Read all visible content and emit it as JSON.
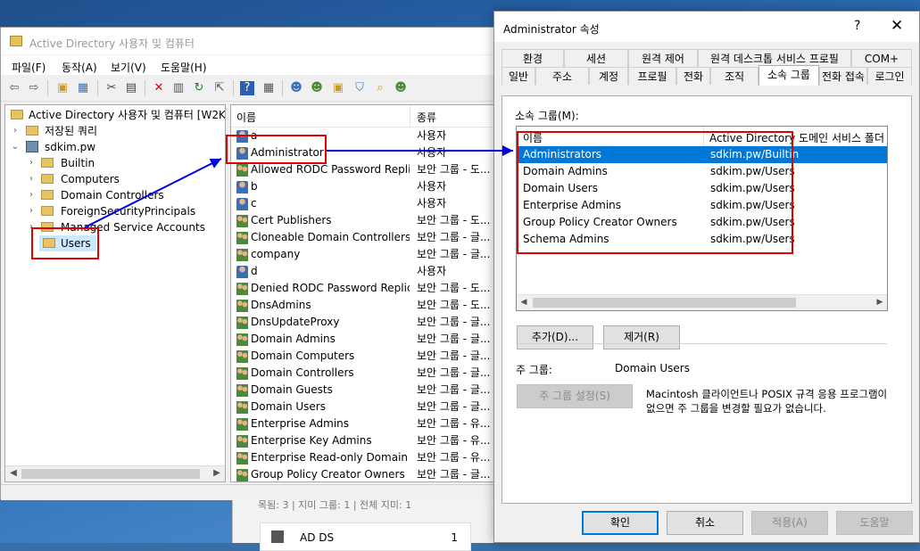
{
  "background": {
    "status_fragment": "목됨: 3  |  지미 그룹: 1  |  전체 지미: 1",
    "tile_label": "AD DS",
    "tile_count": "1"
  },
  "aduc": {
    "title": "Active Directory 사용자 및 컴퓨터",
    "menu": [
      "파일(F)",
      "동작(A)",
      "보기(V)",
      "도움말(H)"
    ],
    "toolbar_icons": [
      "back-icon",
      "forward-icon",
      "up-icon",
      "show-tree-icon",
      "cut-icon",
      "copy-icon",
      "delete-icon",
      "properties-icon",
      "refresh-icon",
      "export-icon",
      "help-icon",
      "view-icon",
      "new-user-icon",
      "new-group-icon",
      "new-ou-icon",
      "filter-icon",
      "find-icon",
      "add-to-group-icon"
    ],
    "tree": {
      "root": "Active Directory 사용자 및 컴퓨터 [W2K1",
      "saved_queries": "저장된 쿼리",
      "domain": "sdkim.pw",
      "children": [
        "Builtin",
        "Computers",
        "Domain Controllers",
        "ForeignSecurityPrincipals",
        "Managed Service Accounts",
        "Users"
      ]
    },
    "list": {
      "col_name": "이름",
      "col_type": "종류",
      "rows": [
        {
          "name": "a",
          "type": "사용자",
          "kind": "user"
        },
        {
          "name": "Administrator",
          "type": "사용자",
          "kind": "user"
        },
        {
          "name": "Allowed RODC Password Repli...",
          "type": "보안 그룹 - 도...",
          "kind": "group"
        },
        {
          "name": "b",
          "type": "사용자",
          "kind": "user"
        },
        {
          "name": "c",
          "type": "사용자",
          "kind": "user"
        },
        {
          "name": "Cert Publishers",
          "type": "보안 그룹 - 도...",
          "kind": "group"
        },
        {
          "name": "Cloneable Domain Controllers",
          "type": "보안 그룹 - 글...",
          "kind": "group"
        },
        {
          "name": "company",
          "type": "보안 그룹 - 글...",
          "kind": "group"
        },
        {
          "name": "d",
          "type": "사용자",
          "kind": "user"
        },
        {
          "name": "Denied RODC Password Replic...",
          "type": "보안 그룹 - 도...",
          "kind": "group"
        },
        {
          "name": "DnsAdmins",
          "type": "보안 그룹 - 도...",
          "kind": "group"
        },
        {
          "name": "DnsUpdateProxy",
          "type": "보안 그룹 - 글...",
          "kind": "group"
        },
        {
          "name": "Domain Admins",
          "type": "보안 그룹 - 글...",
          "kind": "group"
        },
        {
          "name": "Domain Computers",
          "type": "보안 그룹 - 글...",
          "kind": "group"
        },
        {
          "name": "Domain Controllers",
          "type": "보안 그룹 - 글...",
          "kind": "group"
        },
        {
          "name": "Domain Guests",
          "type": "보안 그룹 - 글...",
          "kind": "group"
        },
        {
          "name": "Domain Users",
          "type": "보안 그룹 - 글...",
          "kind": "group"
        },
        {
          "name": "Enterprise Admins",
          "type": "보안 그룹 - 유...",
          "kind": "group"
        },
        {
          "name": "Enterprise Key Admins",
          "type": "보안 그룹 - 유...",
          "kind": "group"
        },
        {
          "name": "Enterprise Read-only Domain ...",
          "type": "보안 그룹 - 유...",
          "kind": "group"
        },
        {
          "name": "Group Policy Creator Owners",
          "type": "보안 그룹 - 글...",
          "kind": "group"
        }
      ]
    }
  },
  "dialog": {
    "title": "Administrator 속성",
    "help": "?",
    "close": "✕",
    "tabs_row1": [
      "환경",
      "세션",
      "원격 제어",
      "원격 데스크톱 서비스 프로필",
      "COM+"
    ],
    "tabs_row2": [
      "일반",
      "주소",
      "계정",
      "프로필",
      "전화",
      "조직",
      "소속 그룹",
      "전화 접속",
      "로그인"
    ],
    "member_of_label": "소속 그룹(M):",
    "grid": {
      "col_name": "이름",
      "col_path": "Active Directory 도메인 서비스 폴더",
      "rows": [
        {
          "name": "Administrators",
          "path": "sdkim.pw/Builtin"
        },
        {
          "name": "Domain Admins",
          "path": "sdkim.pw/Users"
        },
        {
          "name": "Domain Users",
          "path": "sdkim.pw/Users"
        },
        {
          "name": "Enterprise Admins",
          "path": "sdkim.pw/Users"
        },
        {
          "name": "Group Policy Creator Owners",
          "path": "sdkim.pw/Users"
        },
        {
          "name": "Schema Admins",
          "path": "sdkim.pw/Users"
        }
      ]
    },
    "add_button": "추가(D)...",
    "remove_button": "제거(R)",
    "primary_group_label": "주 그룹:",
    "primary_group_value": "Domain Users",
    "set_primary_button": "주 그룹 설정(S)",
    "note": "Macintosh 클라이언트나 POSIX 규격 응용 프로그램이 없으면 주 그룹을 변경할 필요가 없습니다.",
    "ok": "확인",
    "cancel": "취소",
    "apply": "적용(A)",
    "help_button": "도움말"
  },
  "colors": {
    "annotation_red": "#e00000",
    "annotation_arrow": "#0000dd",
    "selection": "#0078d7"
  }
}
